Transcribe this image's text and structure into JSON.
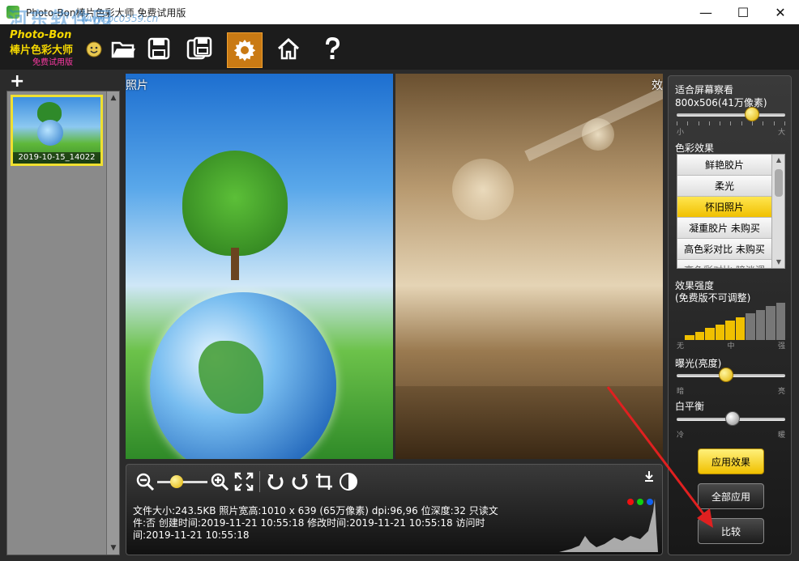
{
  "window": {
    "title": "Photo-Bon棒片色彩大师 免费试用版",
    "watermark": "河东软件园",
    "watermark_url": "www.pc0359.cn",
    "controls": {
      "minimize": "—",
      "maximize": "☐",
      "close": "✕"
    }
  },
  "logo": {
    "line1": "Photo-Bon",
    "line2": "棒片色彩大师",
    "line3": "免费试用版"
  },
  "toolbar": {
    "icons": [
      "smiley-icon",
      "folder-open-icon",
      "save-icon",
      "save-as-icon",
      "settings-icon",
      "home-icon",
      "help-icon"
    ],
    "active": "settings-icon",
    "accent": "#c97a14"
  },
  "thumbnails": {
    "add_label": "+",
    "items": [
      {
        "caption": "2019-10-15_14022"
      }
    ]
  },
  "panes": {
    "left_label": "照片",
    "right_label": "效"
  },
  "info": {
    "line1": "文件大小:243.5KB    照片宽高:1010 x 639 (65万像素)    dpi:96,96    位深度:32    只读文",
    "line2": "件:否    创建时间:2019-11-21 10:55:18    修改时间:2019-11-21 10:55:18    访问时",
    "line3": "间:2019-11-21 10:55:18",
    "zoom_level": 0.35
  },
  "right_panel": {
    "view_label": "适合屏幕察看",
    "resolution": "800x506(41万像素)",
    "view_slider": {
      "min_label": "小",
      "max_label": "大",
      "value": 0.72
    },
    "effects_title": "色彩效果",
    "effects": [
      {
        "label": "鲜艳胶片",
        "selected": false
      },
      {
        "label": "柔光",
        "selected": false
      },
      {
        "label": "怀旧照片",
        "selected": true
      },
      {
        "label": "凝重胶片 未购买",
        "selected": false
      },
      {
        "label": "高色彩对比 未购买",
        "selected": false
      },
      {
        "label": "高色彩对比 暗淡调",
        "selected": false
      }
    ],
    "strength_title": "效果强度",
    "strength_note": "(免费版不可调整)",
    "strength_labels": {
      "low": "无",
      "mid": "中",
      "high": "强"
    },
    "strength_level": 6,
    "strength_total": 10,
    "exposure_title": "曝光(亮度)",
    "exposure_labels": {
      "low": "暗",
      "high": "亮"
    },
    "exposure_value": 0.45,
    "wb_title": "白平衡",
    "wb_labels": {
      "low": "冷",
      "high": "暖"
    },
    "wb_value": 0.52,
    "apply_label": "应用效果",
    "apply_all_label": "全部应用",
    "compare_label": "比较"
  },
  "colors": {
    "gold": "#f0c000",
    "arrow": "#e02020"
  }
}
